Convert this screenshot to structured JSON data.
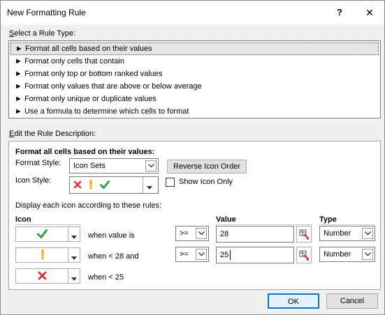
{
  "window": {
    "title": "New Formatting Rule",
    "help_label": "?",
    "close_label": "✕"
  },
  "rule_type": {
    "label_prefix": "S",
    "label_rest": "elect a Rule Type:",
    "bullet": "►",
    "items": [
      "Format all cells based on their values",
      "Format only cells that contain",
      "Format only top or bottom ranked values",
      "Format only values that are above or below average",
      "Format only unique or duplicate values",
      "Use a formula to determine which cells to format"
    ]
  },
  "description": {
    "label_prefix": "E",
    "label_rest": "dit the Rule Description:",
    "heading": "Format all cells based on their values:",
    "format_style_label": "Format Style:",
    "format_style_value": "Icon Sets",
    "reverse_button": "Reverse Icon Order",
    "icon_style_label": "Icon Style:",
    "show_icon_only_label": "Show Icon Only",
    "show_icon_only_checked": false,
    "rules_intro": "Display each icon according to these rules:",
    "col_icon": "Icon",
    "col_value": "Value",
    "col_type": "Type",
    "rows": [
      {
        "icon": "green-check-icon",
        "condition": "when value is",
        "operator": ">=",
        "value": "28",
        "type": "Number"
      },
      {
        "icon": "yellow-exclamation-icon",
        "condition": "when < 28 and",
        "operator": ">=",
        "value": "25",
        "type": "Number"
      },
      {
        "icon": "red-x-icon",
        "condition": "when < 25"
      }
    ]
  },
  "footer": {
    "ok_label": "OK",
    "cancel_label": "Cancel"
  },
  "colors": {
    "accent": "#0078d7",
    "check": "#2f9e44",
    "exclaim": "#f2a900",
    "cross": "#e03131"
  }
}
